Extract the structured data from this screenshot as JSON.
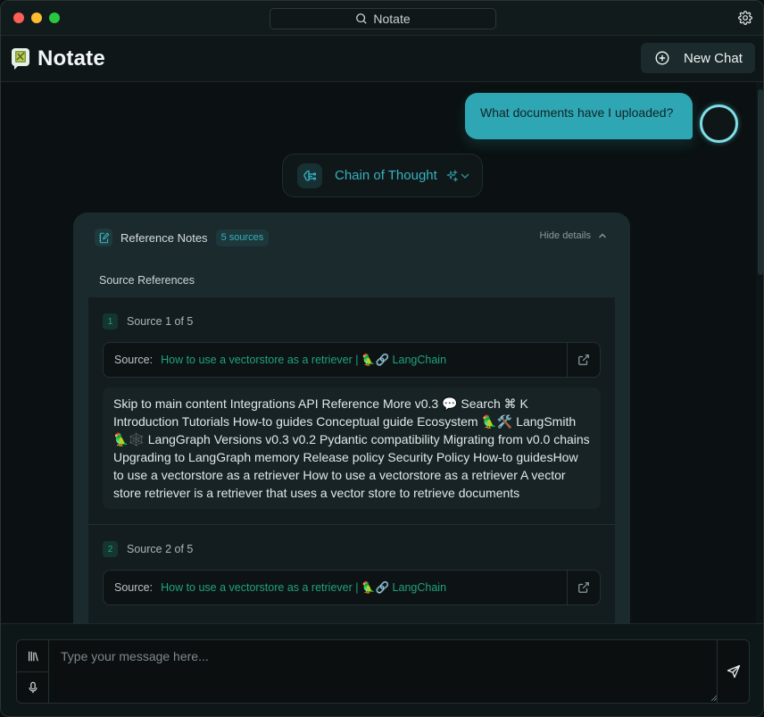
{
  "window": {
    "search_title": "Notate",
    "traffic_lights": [
      "close",
      "minimize",
      "zoom"
    ]
  },
  "header": {
    "app_name": "Notate",
    "new_chat_label": "New Chat"
  },
  "chat": {
    "user_message": "What documents have I uploaded?",
    "chain_of_thought_label": "Chain of Thought",
    "reference_panel": {
      "title": "Reference Notes",
      "sources_badge": "5 sources",
      "hide_details_label": "Hide details",
      "section_label": "Source References",
      "sources": [
        {
          "number": "1",
          "label": "Source 1 of 5",
          "link_label": "Source:",
          "link_text": "How to use a vectorstore as a retriever | 🦜🔗 LangChain",
          "content": "Skip to main content Integrations API Reference More v0.3 💬 Search ⌘ K Introduction Tutorials How-to guides Conceptual guide Ecosystem 🦜🛠️ LangSmith 🦜🕸️ LangGraph Versions v0.3 v0.2 Pydantic compatibility Migrating from v0.0 chains Upgrading to LangGraph memory Release policy Security Policy How-to guidesHow to use a vectorstore as a retriever How to use a vectorstore as a retriever A vector store retriever is a retriever that uses a vector store to retrieve documents"
        },
        {
          "number": "2",
          "label": "Source 2 of 5",
          "link_label": "Source:",
          "link_text": "How to use a vectorstore as a retriever | 🦜🔗 LangChain",
          "content": ""
        }
      ]
    }
  },
  "composer": {
    "placeholder": "Type your message here...",
    "value": ""
  },
  "colors": {
    "accent": "#2fa6b3",
    "link_green": "#1fa27c",
    "background": "#0b1112"
  }
}
